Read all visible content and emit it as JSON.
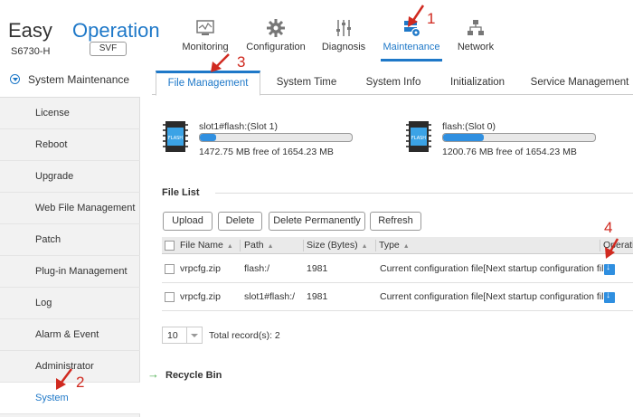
{
  "brand": {
    "part1": "Easy",
    "part2": "Operation",
    "model": "S6730-H",
    "mode_button": "SVF"
  },
  "nav": [
    {
      "label": "Monitoring",
      "icon": "monitor-icon"
    },
    {
      "label": "Configuration",
      "icon": "gear-icon"
    },
    {
      "label": "Diagnosis",
      "icon": "sliders-icon"
    },
    {
      "label": "Maintenance",
      "icon": "maintenance-icon",
      "active": true
    },
    {
      "label": "Network",
      "icon": "network-topology-icon"
    }
  ],
  "sidebar": {
    "section_title": "System Maintenance",
    "items": [
      {
        "label": "License"
      },
      {
        "label": "Reboot"
      },
      {
        "label": "Upgrade"
      },
      {
        "label": "Web File Management"
      },
      {
        "label": "Patch"
      },
      {
        "label": "Plug-in Management"
      },
      {
        "label": "Log"
      },
      {
        "label": "Alarm & Event"
      },
      {
        "label": "Administrator"
      },
      {
        "label": "System",
        "active": true
      }
    ]
  },
  "tabs": [
    {
      "label": "File Management",
      "active": true
    },
    {
      "label": "System Time"
    },
    {
      "label": "System Info"
    },
    {
      "label": "Initialization"
    },
    {
      "label": "Service Management"
    }
  ],
  "storage": [
    {
      "name": "slot1#flash:(Slot 1)",
      "free": "1472.75 MB free of 1654.23 MB",
      "used_fraction": 0.11,
      "chip_label": "FLASH"
    },
    {
      "name": "flash:(Slot 0)",
      "free": "1200.76 MB free of 1654.23 MB",
      "used_fraction": 0.27,
      "chip_label": "FLASH"
    }
  ],
  "file_list": {
    "title": "File List",
    "buttons": {
      "upload": "Upload",
      "delete": "Delete",
      "delete_permanently": "Delete Permanently",
      "refresh": "Refresh"
    },
    "columns": {
      "name": "File Name",
      "path": "Path",
      "size": "Size (Bytes)",
      "type": "Type",
      "operation": "Operation"
    },
    "rows": [
      {
        "name": "vrpcfg.zip",
        "path": "flash:/",
        "size": "1981",
        "type": "Current configuration file[Next startup configuration file]"
      },
      {
        "name": "vrpcfg.zip",
        "path": "slot1#flash:/",
        "size": "1981",
        "type": "Current configuration file[Next startup configuration file]"
      }
    ],
    "page_size": "10",
    "total": "Total record(s): 2"
  },
  "recycle_bin": "Recycle Bin",
  "annotations": [
    "1",
    "2",
    "3",
    "4"
  ],
  "colors": {
    "accent": "#1e78c8",
    "annotation": "#d02a20"
  }
}
